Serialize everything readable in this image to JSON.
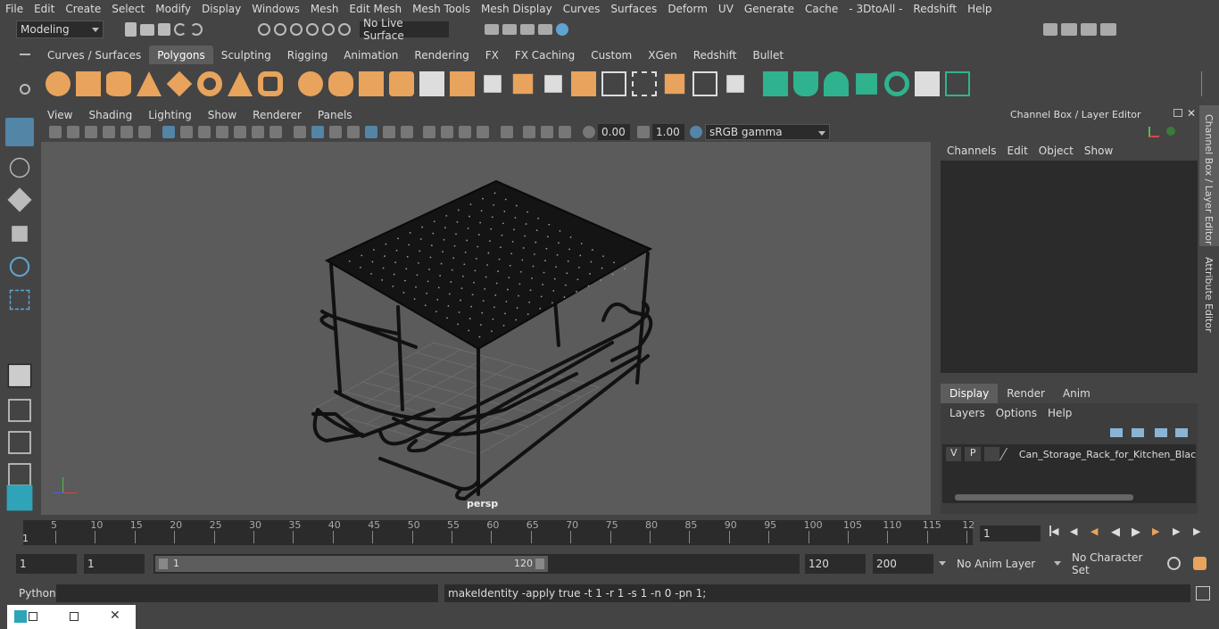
{
  "menubar": {
    "items": [
      "File",
      "Edit",
      "Create",
      "Select",
      "Modify",
      "Display",
      "Windows",
      "Mesh",
      "Edit Mesh",
      "Mesh Tools",
      "Mesh Display",
      "Curves",
      "Surfaces",
      "Deform",
      "UV",
      "Generate",
      "Cache",
      "- 3DtoAll -",
      "Redshift",
      "Help"
    ]
  },
  "statusline": {
    "mode": "Modeling",
    "live_surface": "No Live Surface"
  },
  "shelf": {
    "tabs": [
      "Curves / Surfaces",
      "Polygons",
      "Sculpting",
      "Rigging",
      "Animation",
      "Rendering",
      "FX",
      "FX Caching",
      "Custom",
      "XGen",
      "Redshift",
      "Bullet"
    ],
    "active_tab": "Polygons"
  },
  "panel": {
    "menus": [
      "View",
      "Shading",
      "Lighting",
      "Show",
      "Renderer",
      "Panels"
    ],
    "exposure": "0.00",
    "gamma": "1.00",
    "colorspace": "sRGB gamma",
    "camera_label": "persp"
  },
  "channelbox": {
    "title": "Channel Box / Layer Editor",
    "menus": [
      "Channels",
      "Edit",
      "Object",
      "Show"
    ]
  },
  "layers": {
    "tabs": [
      "Display",
      "Render",
      "Anim"
    ],
    "active_tab": "Display",
    "menus": [
      "Layers",
      "Options",
      "Help"
    ],
    "row": {
      "v": "V",
      "p": "P",
      "name": "Can_Storage_Rack_for_Kitchen_Black"
    }
  },
  "sidetabs": {
    "channel": "Channel Box / Layer Editor",
    "attribute": "Attribute Editor"
  },
  "timeline": {
    "ticks": [
      "5",
      "10",
      "15",
      "20",
      "25",
      "30",
      "35",
      "40",
      "45",
      "50",
      "55",
      "60",
      "65",
      "70",
      "75",
      "80",
      "85",
      "90",
      "95",
      "100",
      "105",
      "110",
      "115",
      "12"
    ],
    "start_marker": "1",
    "current_frame": "1"
  },
  "range": {
    "start": "1",
    "current": "1",
    "slider_start": "1",
    "slider_end": "120",
    "end": "120",
    "max": "200",
    "anim_layer": "No Anim Layer",
    "char_set": "No Character Set"
  },
  "cmd": {
    "lang": "Python",
    "output": "makeIdentity -apply true -t 1 -r 1 -s 1 -n 0 -pn 1;"
  },
  "colors": {
    "accent": "#5285a6",
    "shelf_icon": "#e8a35c",
    "shelf_green": "#2fb38f",
    "viewport_bg": "#5b5b5b"
  }
}
